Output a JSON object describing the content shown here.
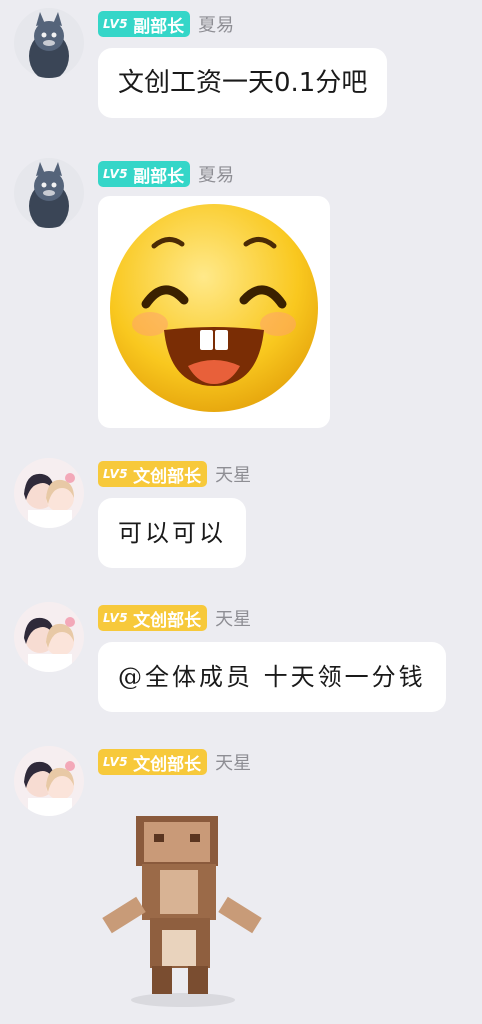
{
  "messages": [
    {
      "badge_level": "LV5",
      "badge_title": "副部长",
      "badge_color": "#35d6c8",
      "username": "夏易",
      "text": "文创工资一天0.1分吧",
      "avatar": "tom-cat-avatar"
    },
    {
      "badge_level": "LV5",
      "badge_title": "副部长",
      "badge_color": "#35d6c8",
      "username": "夏易",
      "sticker": "grinning-emoji-sticker",
      "avatar": "tom-cat-avatar"
    },
    {
      "badge_level": "LV5",
      "badge_title": "文创部长",
      "badge_color": "#f7c93b",
      "username": "天星",
      "text": "可以可以",
      "avatar": "anime-couple-avatar"
    },
    {
      "badge_level": "LV5",
      "badge_title": "文创部长",
      "badge_color": "#f7c93b",
      "username": "天星",
      "text": "@全体成员  十天领一分钱",
      "avatar": "anime-couple-avatar"
    },
    {
      "badge_level": "LV5",
      "badge_title": "文创部长",
      "badge_color": "#f7c93b",
      "username": "天星",
      "sticker": "pixel-figure-sticker",
      "avatar": "anime-couple-avatar"
    }
  ]
}
